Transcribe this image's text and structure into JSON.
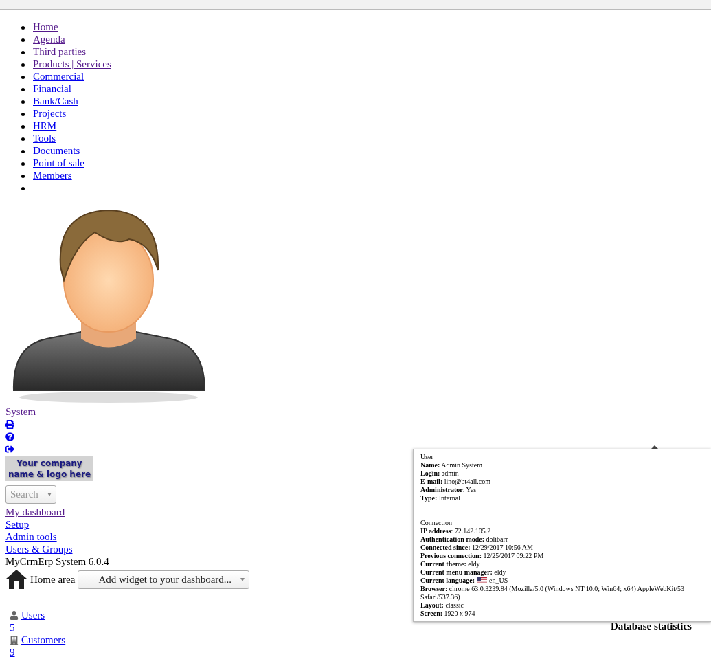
{
  "menu": {
    "items": [
      {
        "label": "Home",
        "visited": true
      },
      {
        "label": "Agenda",
        "visited": true
      },
      {
        "label": "Third parties",
        "visited": true
      },
      {
        "label": "Products | Services",
        "visited": true
      },
      {
        "label": "Commercial",
        "visited": false
      },
      {
        "label": "Financial",
        "visited": false
      },
      {
        "label": "Bank/Cash",
        "visited": false
      },
      {
        "label": "Projects",
        "visited": false
      },
      {
        "label": "HRM",
        "visited": false
      },
      {
        "label": "Tools",
        "visited": false
      },
      {
        "label": "Documents",
        "visited": false
      },
      {
        "label": "Point of sale",
        "visited": false
      },
      {
        "label": "Members",
        "visited": false
      }
    ],
    "trailing_bullet": true
  },
  "user_link": {
    "label": "System",
    "visited": true
  },
  "actions": [
    {
      "kind": "print"
    },
    {
      "kind": "help"
    },
    {
      "kind": "logout"
    }
  ],
  "company_logo": {
    "lines": [
      "Your company",
      "name & logo here"
    ]
  },
  "search": {
    "placeholder": "Search"
  },
  "left_links": [
    {
      "label": "My dashboard",
      "visited": true
    },
    {
      "label": "Setup",
      "visited": false
    },
    {
      "label": "Admin tools",
      "visited": false
    },
    {
      "label": "Users & Groups",
      "visited": false
    }
  ],
  "version": "MyCrmErp System 6.0.4",
  "home_area": {
    "label": "Home area",
    "widget_select": "Add widget to your dashboard..."
  },
  "stats": [
    {
      "kind": "user",
      "label": "Users",
      "count": "5"
    },
    {
      "kind": "customer",
      "label": "Customers",
      "count": "9"
    }
  ],
  "tooltip": {
    "sections": [
      {
        "heading": "User",
        "rows": [
          {
            "label": "Name:",
            "value": " Admin System"
          },
          {
            "label": "Login:",
            "value": " admin"
          },
          {
            "label": "E-mail:",
            "value": " lino@bt4all.com"
          },
          {
            "label": "Administrator",
            "value": ": Yes"
          },
          {
            "label": "Type:",
            "value": " Internal"
          }
        ]
      },
      {
        "heading": "Connection",
        "rows": [
          {
            "label": "IP address",
            "value": ": 72.142.105.2"
          },
          {
            "label": "Authentication mode:",
            "value": " dolibarr"
          },
          {
            "label": "Connected since:",
            "value": " 12/29/2017 10:56 AM"
          },
          {
            "label": "Previous connection:",
            "value": " 12/25/2017 09:22 PM"
          },
          {
            "label": "Current theme:",
            "value": " eldy"
          },
          {
            "label": "Current menu manager:",
            "value": " eldy"
          },
          {
            "label": "Current language:",
            "value": "en_US",
            "kind": "flag"
          },
          {
            "label": "Browser:",
            "value": " chrome 63.0.3239.84 (Mozilla/5.0 (Windows NT 10.0; Win64; x64) AppleWebKit/53",
            "continuation": "Safari/537.36)"
          },
          {
            "label": "Layout:",
            "value": " classic"
          },
          {
            "label": "Screen:",
            "value": " 1920 x 974"
          }
        ]
      }
    ]
  },
  "db_stats_title": "Database statistics"
}
